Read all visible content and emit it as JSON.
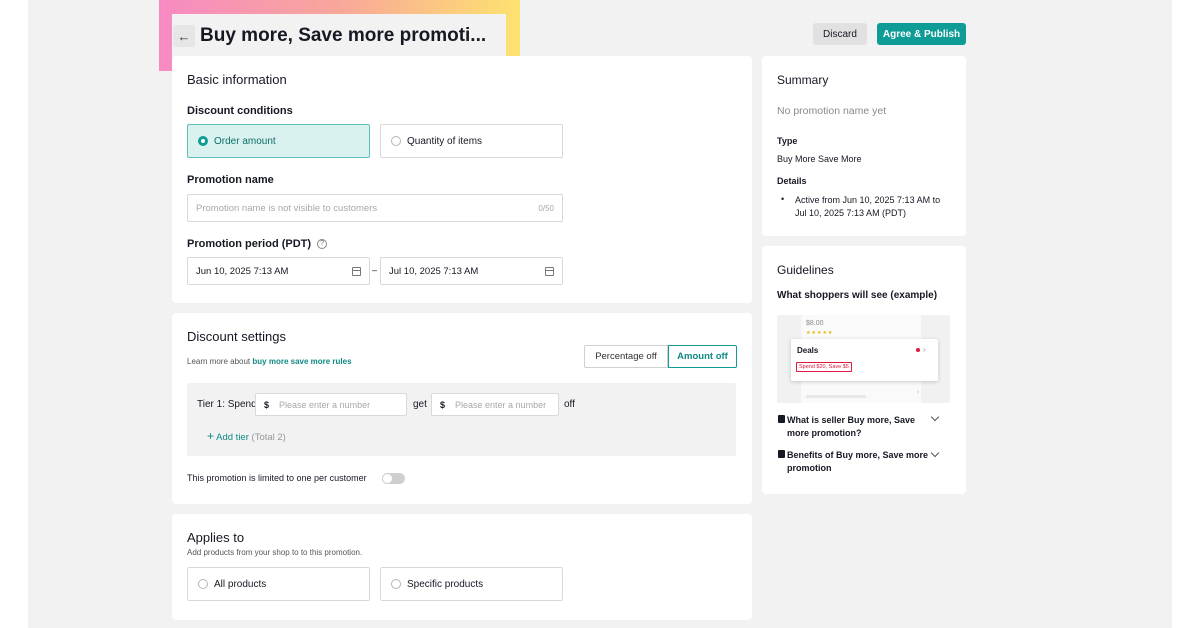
{
  "header": {
    "title": "Buy more, Save more promoti...",
    "discard_label": "Discard",
    "publish_label": "Agree & Publish"
  },
  "basic": {
    "title": "Basic information",
    "discount_conditions_label": "Discount conditions",
    "options": [
      "Order amount",
      "Quantity of items"
    ],
    "selected": "Order amount",
    "promotion_name_label": "Promotion name",
    "promotion_name_placeholder": "Promotion name is not visible to customers",
    "promotion_name_counter": "0/50",
    "period_label": "Promotion period (PDT)",
    "start": "Jun 10, 2025 7:13 AM",
    "separator": "–",
    "end": "Jul 10, 2025 7:13 AM"
  },
  "discount": {
    "title": "Discount settings",
    "learn_prefix": "Learn more about",
    "learn_link": "buy more save more rules",
    "modes": [
      "Percentage off",
      "Amount off"
    ],
    "selected_mode": "Amount off",
    "tier_label": "Tier 1: Spend",
    "currency": "$",
    "amount_placeholder": "Please enter a number",
    "get_label": "get",
    "off_label": "off",
    "add_tier_label": "Add tier",
    "add_tier_total": "(Total 2)",
    "limit_label": "This promotion is limited to one per customer"
  },
  "applies": {
    "title": "Applies to",
    "subtitle": "Add products from your shop to to this promotion.",
    "options": [
      "All products",
      "Specific products"
    ]
  },
  "summary": {
    "title": "Summary",
    "no_name": "No promotion name yet",
    "type_label": "Type",
    "type_value": "Buy More Save More",
    "details_label": "Details",
    "details_line1": "Active from Jun 10, 2025 7:13 AM to",
    "details_line2": "Jul 10, 2025 7:13 AM (PDT)"
  },
  "guidelines": {
    "title": "Guidelines",
    "example_label": "What shoppers will see (example)",
    "preview_price": "$8.00",
    "preview_deals": "Deals",
    "preview_tag": "Spend $20, Save $5",
    "faq": [
      {
        "line1": "What is seller Buy more, Save",
        "line2": "more promotion?"
      },
      {
        "line1": "Benefits of Buy more, Save more",
        "line2": "promotion"
      }
    ]
  },
  "colors": {
    "accent": "#0f9c97",
    "selected_bg": "#d9f1ef"
  }
}
